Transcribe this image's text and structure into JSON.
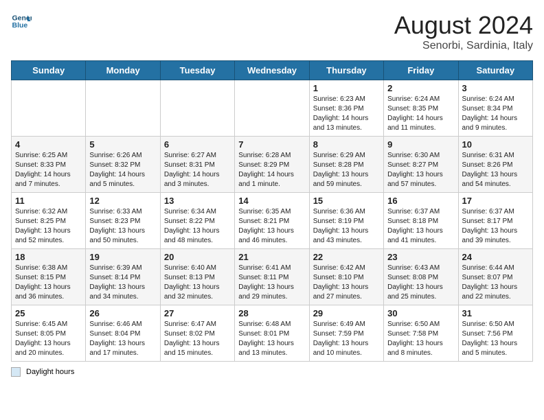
{
  "header": {
    "logo_line1": "General",
    "logo_line2": "Blue",
    "title": "August 2024",
    "subtitle": "Senorbi, Sardinia, Italy"
  },
  "weekdays": [
    "Sunday",
    "Monday",
    "Tuesday",
    "Wednesday",
    "Thursday",
    "Friday",
    "Saturday"
  ],
  "weeks": [
    [
      {
        "day": "",
        "info": ""
      },
      {
        "day": "",
        "info": ""
      },
      {
        "day": "",
        "info": ""
      },
      {
        "day": "",
        "info": ""
      },
      {
        "day": "1",
        "info": "Sunrise: 6:23 AM\nSunset: 8:36 PM\nDaylight: 14 hours\nand 13 minutes."
      },
      {
        "day": "2",
        "info": "Sunrise: 6:24 AM\nSunset: 8:35 PM\nDaylight: 14 hours\nand 11 minutes."
      },
      {
        "day": "3",
        "info": "Sunrise: 6:24 AM\nSunset: 8:34 PM\nDaylight: 14 hours\nand 9 minutes."
      }
    ],
    [
      {
        "day": "4",
        "info": "Sunrise: 6:25 AM\nSunset: 8:33 PM\nDaylight: 14 hours\nand 7 minutes."
      },
      {
        "day": "5",
        "info": "Sunrise: 6:26 AM\nSunset: 8:32 PM\nDaylight: 14 hours\nand 5 minutes."
      },
      {
        "day": "6",
        "info": "Sunrise: 6:27 AM\nSunset: 8:31 PM\nDaylight: 14 hours\nand 3 minutes."
      },
      {
        "day": "7",
        "info": "Sunrise: 6:28 AM\nSunset: 8:29 PM\nDaylight: 14 hours\nand 1 minute."
      },
      {
        "day": "8",
        "info": "Sunrise: 6:29 AM\nSunset: 8:28 PM\nDaylight: 13 hours\nand 59 minutes."
      },
      {
        "day": "9",
        "info": "Sunrise: 6:30 AM\nSunset: 8:27 PM\nDaylight: 13 hours\nand 57 minutes."
      },
      {
        "day": "10",
        "info": "Sunrise: 6:31 AM\nSunset: 8:26 PM\nDaylight: 13 hours\nand 54 minutes."
      }
    ],
    [
      {
        "day": "11",
        "info": "Sunrise: 6:32 AM\nSunset: 8:25 PM\nDaylight: 13 hours\nand 52 minutes."
      },
      {
        "day": "12",
        "info": "Sunrise: 6:33 AM\nSunset: 8:23 PM\nDaylight: 13 hours\nand 50 minutes."
      },
      {
        "day": "13",
        "info": "Sunrise: 6:34 AM\nSunset: 8:22 PM\nDaylight: 13 hours\nand 48 minutes."
      },
      {
        "day": "14",
        "info": "Sunrise: 6:35 AM\nSunset: 8:21 PM\nDaylight: 13 hours\nand 46 minutes."
      },
      {
        "day": "15",
        "info": "Sunrise: 6:36 AM\nSunset: 8:19 PM\nDaylight: 13 hours\nand 43 minutes."
      },
      {
        "day": "16",
        "info": "Sunrise: 6:37 AM\nSunset: 8:18 PM\nDaylight: 13 hours\nand 41 minutes."
      },
      {
        "day": "17",
        "info": "Sunrise: 6:37 AM\nSunset: 8:17 PM\nDaylight: 13 hours\nand 39 minutes."
      }
    ],
    [
      {
        "day": "18",
        "info": "Sunrise: 6:38 AM\nSunset: 8:15 PM\nDaylight: 13 hours\nand 36 minutes."
      },
      {
        "day": "19",
        "info": "Sunrise: 6:39 AM\nSunset: 8:14 PM\nDaylight: 13 hours\nand 34 minutes."
      },
      {
        "day": "20",
        "info": "Sunrise: 6:40 AM\nSunset: 8:13 PM\nDaylight: 13 hours\nand 32 minutes."
      },
      {
        "day": "21",
        "info": "Sunrise: 6:41 AM\nSunset: 8:11 PM\nDaylight: 13 hours\nand 29 minutes."
      },
      {
        "day": "22",
        "info": "Sunrise: 6:42 AM\nSunset: 8:10 PM\nDaylight: 13 hours\nand 27 minutes."
      },
      {
        "day": "23",
        "info": "Sunrise: 6:43 AM\nSunset: 8:08 PM\nDaylight: 13 hours\nand 25 minutes."
      },
      {
        "day": "24",
        "info": "Sunrise: 6:44 AM\nSunset: 8:07 PM\nDaylight: 13 hours\nand 22 minutes."
      }
    ],
    [
      {
        "day": "25",
        "info": "Sunrise: 6:45 AM\nSunset: 8:05 PM\nDaylight: 13 hours\nand 20 minutes."
      },
      {
        "day": "26",
        "info": "Sunrise: 6:46 AM\nSunset: 8:04 PM\nDaylight: 13 hours\nand 17 minutes."
      },
      {
        "day": "27",
        "info": "Sunrise: 6:47 AM\nSunset: 8:02 PM\nDaylight: 13 hours\nand 15 minutes."
      },
      {
        "day": "28",
        "info": "Sunrise: 6:48 AM\nSunset: 8:01 PM\nDaylight: 13 hours\nand 13 minutes."
      },
      {
        "day": "29",
        "info": "Sunrise: 6:49 AM\nSunset: 7:59 PM\nDaylight: 13 hours\nand 10 minutes."
      },
      {
        "day": "30",
        "info": "Sunrise: 6:50 AM\nSunset: 7:58 PM\nDaylight: 13 hours\nand 8 minutes."
      },
      {
        "day": "31",
        "info": "Sunrise: 6:50 AM\nSunset: 7:56 PM\nDaylight: 13 hours\nand 5 minutes."
      }
    ]
  ],
  "legend": {
    "box_label": "Daylight hours"
  }
}
